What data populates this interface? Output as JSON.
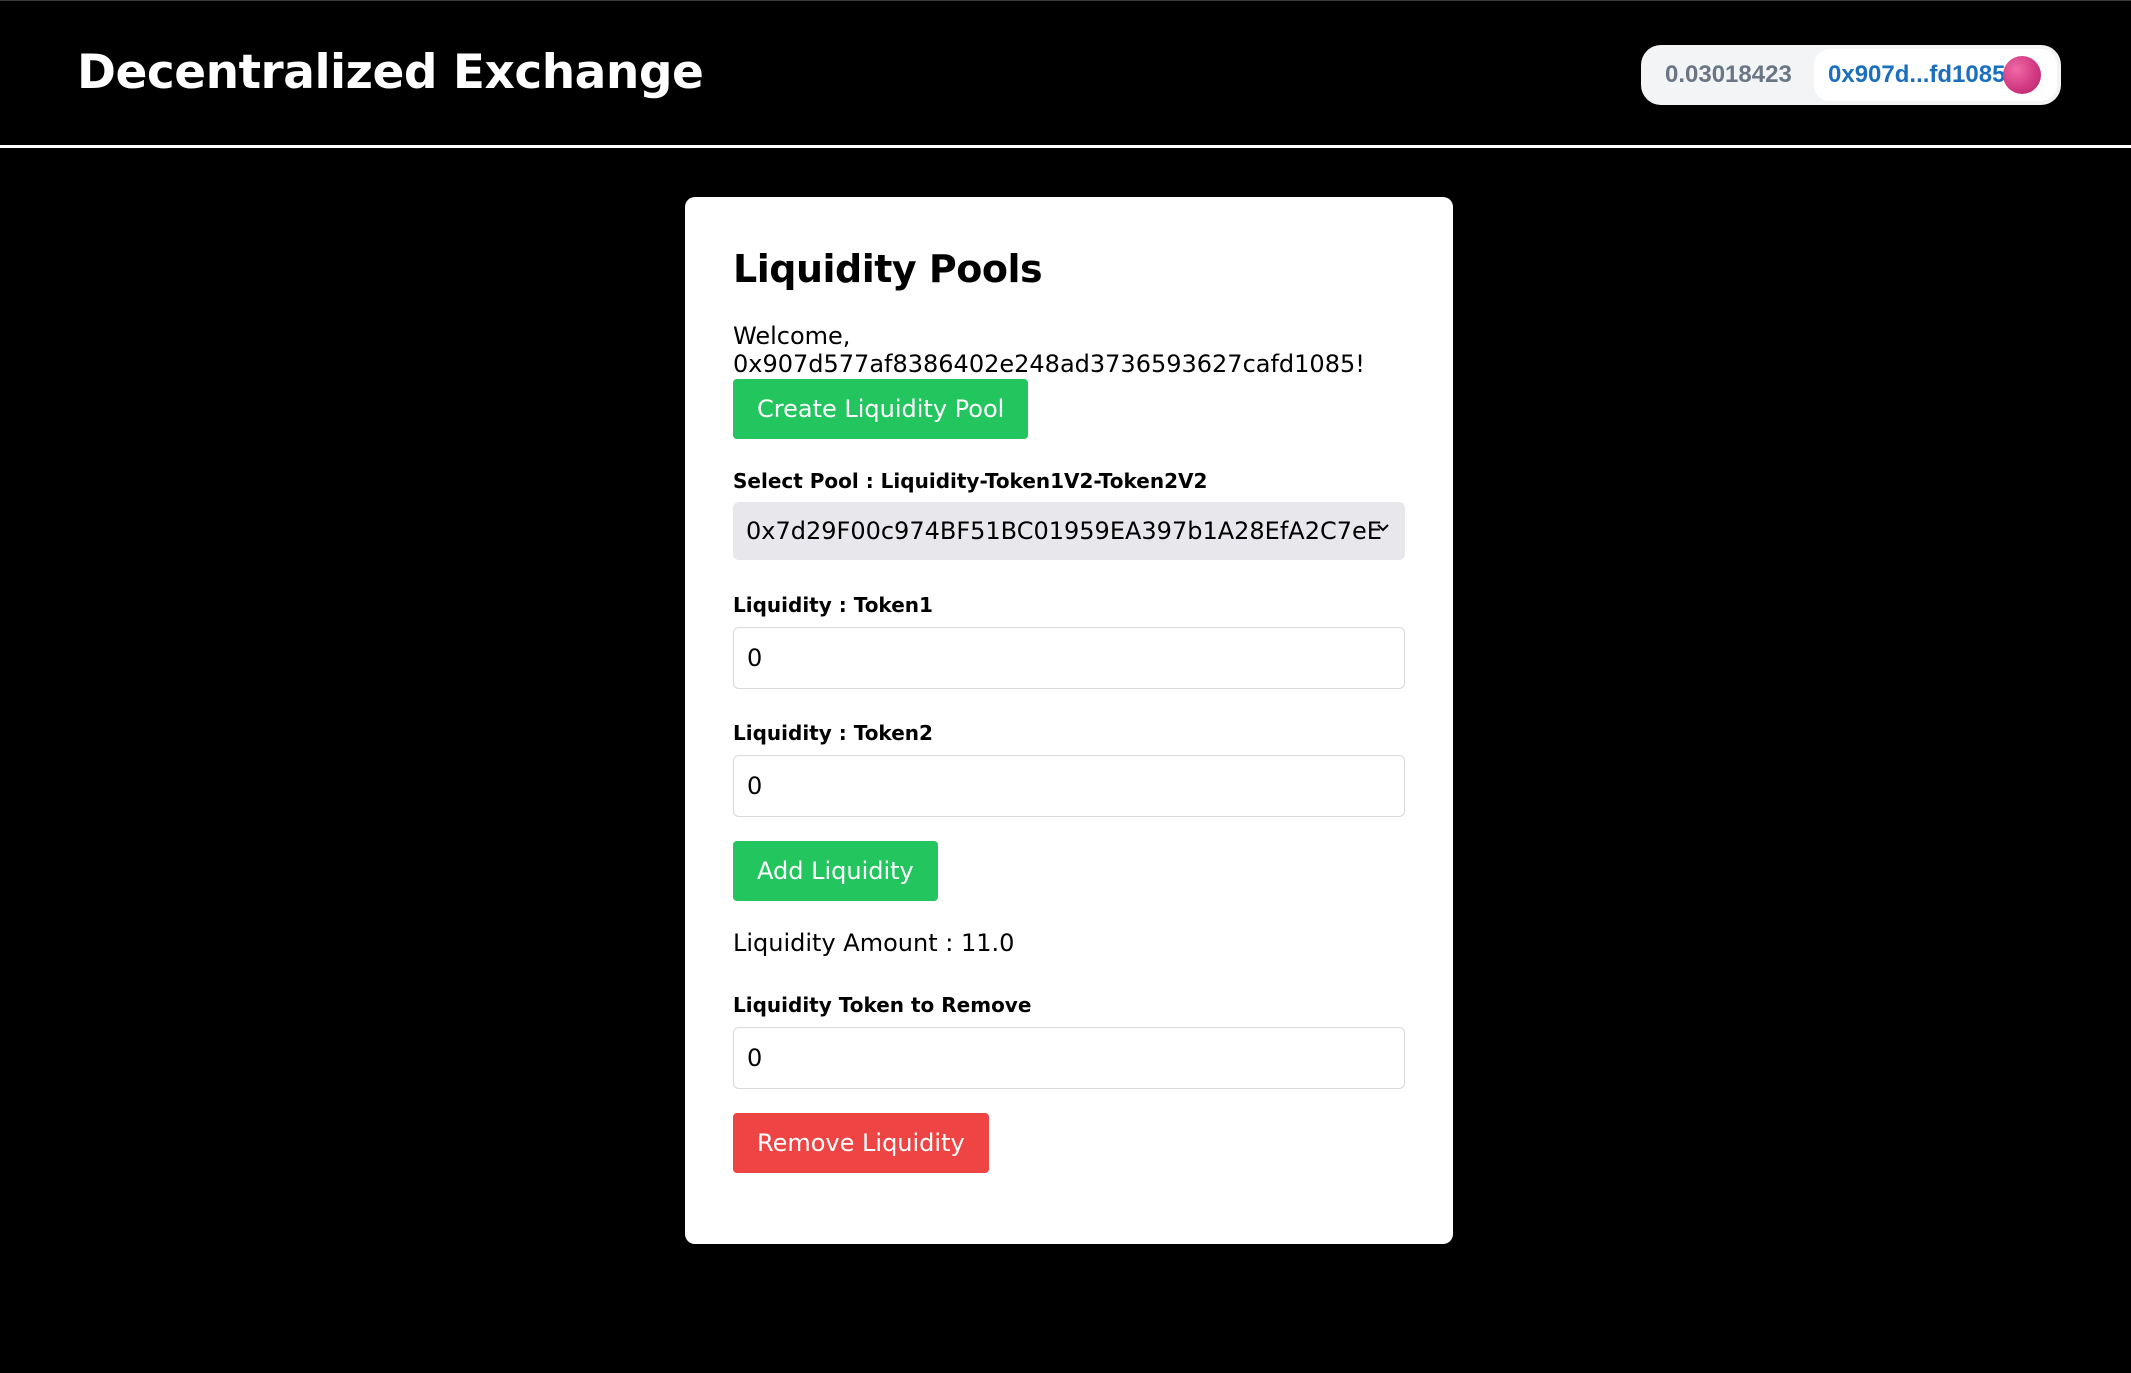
{
  "header": {
    "title": "Decentralized Exchange",
    "wallet": {
      "balance": "0.03018423",
      "address": "0x907d...fd1085",
      "avatar_color": "#d23a84"
    }
  },
  "card": {
    "title": "Liquidity Pools",
    "welcome": "Welcome, 0x907d577af8386402e248ad3736593627cafd1085!",
    "create_pool_label": "Create Liquidity Pool",
    "select_pool_label": "Select Pool : Liquidity-Token1V2-Token2V2",
    "selected_pool": "0x7d29F00c974BF51BC01959EA397b1A28EfA2C7eE",
    "token1_label": "Liquidity : Token1",
    "token1_value": "0",
    "token2_label": "Liquidity : Token2",
    "token2_value": "0",
    "add_liquidity_label": "Add Liquidity",
    "liquidity_amount": "Liquidity Amount : 11.0",
    "remove_token_label": "Liquidity Token to Remove",
    "remove_token_value": "0",
    "remove_liquidity_label": "Remove Liquidity"
  },
  "colors": {
    "green": "#22c55e",
    "red": "#ef4444",
    "address_blue": "#1a6fbf"
  }
}
